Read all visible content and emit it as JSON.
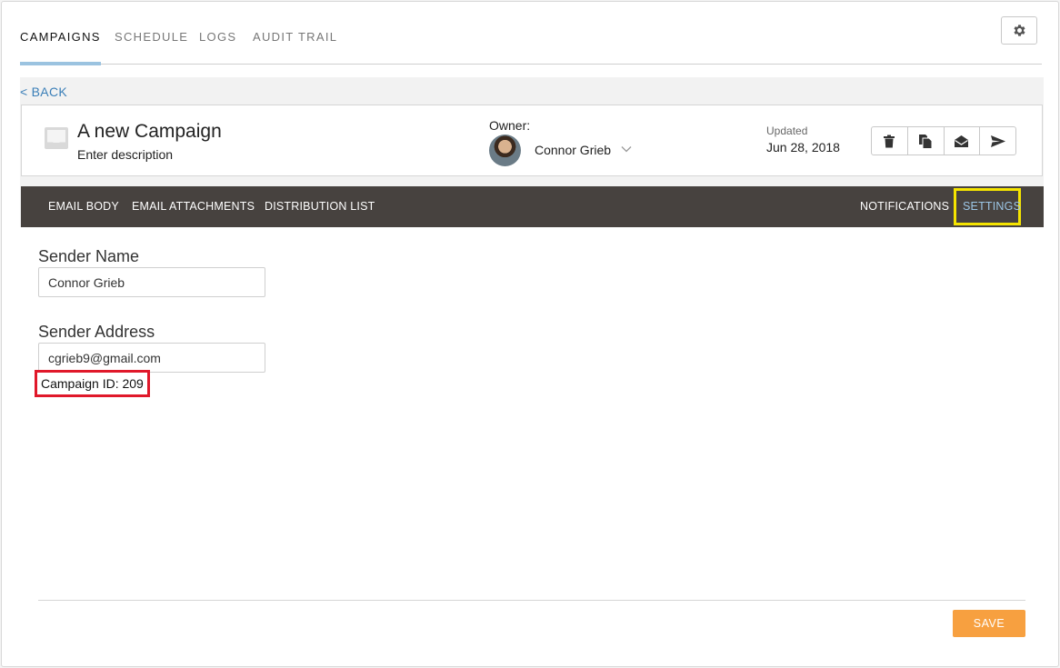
{
  "top_nav": {
    "tabs": [
      {
        "label": "CAMPAIGNS",
        "active": true
      },
      {
        "label": "SCHEDULE",
        "active": false
      },
      {
        "label": "LOGS",
        "active": false
      },
      {
        "label": "AUDIT TRAIL",
        "active": false
      }
    ],
    "settings_icon": "gear-icon"
  },
  "back_label": "< BACK",
  "campaign": {
    "icon": "inbox-icon",
    "title": "A new Campaign",
    "description": "Enter description",
    "owner_label": "Owner:",
    "owner_name": "Connor Grieb",
    "updated_label": "Updated",
    "updated_date": "Jun 28, 2018",
    "actions": [
      "trash-icon",
      "copy-icon",
      "envelope-open-icon",
      "send-icon"
    ]
  },
  "section_tabs": {
    "left": [
      "EMAIL BODY",
      "EMAIL ATTACHMENTS",
      "DISTRIBUTION LIST"
    ],
    "notifications": "NOTIFICATIONS",
    "settings": "SETTINGS",
    "active": "SETTINGS"
  },
  "settings": {
    "sender_name_label": "Sender Name",
    "sender_name_value": "Connor Grieb",
    "sender_address_label": "Sender Address",
    "sender_address_value": "cgrieb9@gmail.com",
    "campaign_id": "Campaign ID: 209"
  },
  "save_label": "SAVE",
  "colors": {
    "accent_blue": "#3b7fb8",
    "tab_bar": "#47423f",
    "save_orange": "#f7a040",
    "highlight_yellow": "#f5e400",
    "highlight_red": "#e0182a"
  }
}
